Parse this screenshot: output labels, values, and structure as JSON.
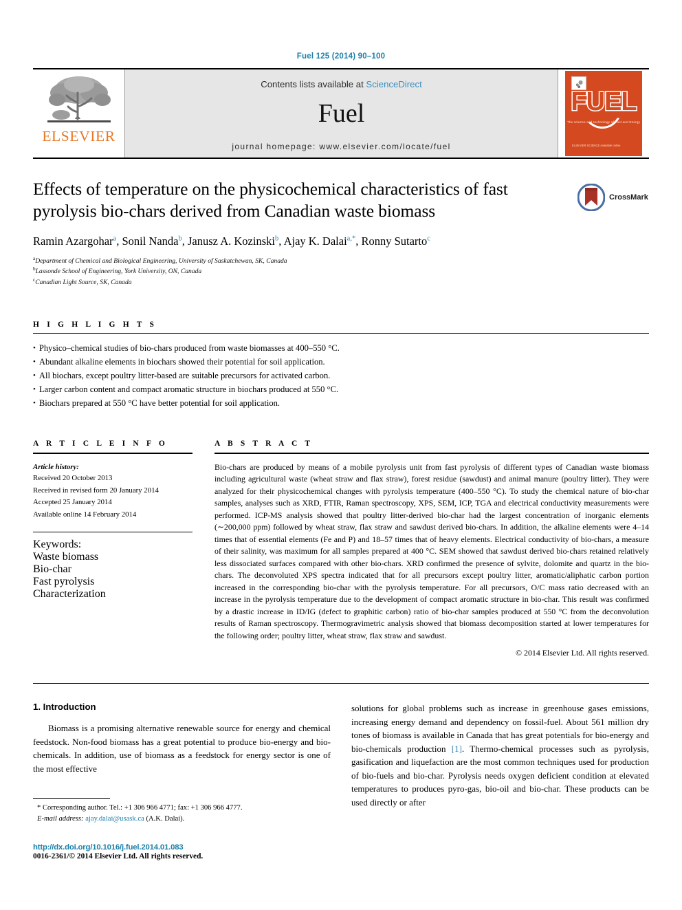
{
  "running_head": "Fuel 125 (2014) 90–100",
  "masthead": {
    "publisher_logo_text": "ELSEVIER",
    "contents_prefix": "Contents lists available at",
    "contents_link": "ScienceDirect",
    "journal_name": "Fuel",
    "homepage_line": "journal homepage: www.elsevier.com/locate/fuel",
    "cover": {
      "title": "FUEL",
      "subtitle": "The science and technology of Fuel and Energy",
      "footer": "ELSEVIER SCIENCE\nAvailable online"
    }
  },
  "article": {
    "title": "Effects of temperature on the physicochemical characteristics of fast pyrolysis bio-chars derived from Canadian waste biomass",
    "crossmark_label": "CrossMark",
    "authors": [
      {
        "name": "Ramin Azargohar",
        "sup": "a",
        "sep": ", "
      },
      {
        "name": "Sonil Nanda",
        "sup": "b",
        "sep": ", "
      },
      {
        "name": "Janusz A. Kozinski",
        "sup": "b",
        "sep": ", "
      },
      {
        "name": "Ajay K. Dalai",
        "sup": "a,*",
        "sep": ", "
      },
      {
        "name": "Ronny Sutarto",
        "sup": "c",
        "sep": ""
      }
    ],
    "affiliations": [
      {
        "sup": "a",
        "text": "Department of Chemical and Biological Engineering, University of Saskatchewan, SK, Canada"
      },
      {
        "sup": "b",
        "text": "Lassonde School of Engineering, York University, ON, Canada"
      },
      {
        "sup": "c",
        "text": "Canadian Light Source, SK, Canada"
      }
    ]
  },
  "highlights": {
    "heading": "H I G H L I G H T S",
    "items": [
      "Physico–chemical studies of bio-chars produced from waste biomasses at 400–550 °C.",
      "Abundant alkaline elements in biochars showed their potential for soil application.",
      "All biochars, except poultry litter-based are suitable precursors for activated carbon.",
      "Larger carbon content and compact aromatic structure in biochars produced at 550 °C.",
      "Biochars prepared at 550 °C have better potential for soil application."
    ]
  },
  "article_info": {
    "heading": "A R T I C L E    I N F O",
    "history_label": "Article history:",
    "history": [
      "Received 20 October 2013",
      "Received in revised form 20 January 2014",
      "Accepted 25 January 2014",
      "Available online 14 February 2014"
    ],
    "keywords_label": "Keywords:",
    "keywords": [
      "Waste biomass",
      "Bio-char",
      "Fast pyrolysis",
      "Characterization"
    ]
  },
  "abstract": {
    "heading": "A B S T R A C T",
    "text": "Bio-chars are produced by means of a mobile pyrolysis unit from fast pyrolysis of different types of Canadian waste biomass including agricultural waste (wheat straw and flax straw), forest residue (sawdust) and animal manure (poultry litter). They were analyzed for their physicochemical changes with pyrolysis temperature (400–550 °C). To study the chemical nature of bio-char samples, analyses such as XRD, FTIR, Raman spectroscopy, XPS, SEM, ICP, TGA and electrical conductivity measurements were performed. ICP-MS analysis showed that poultry litter-derived bio-char had the largest concentration of inorganic elements (∼200,000 ppm) followed by wheat straw, flax straw and sawdust derived bio-chars. In addition, the alkaline elements were 4–14 times that of essential elements (Fe and P) and 18–57 times that of heavy elements. Electrical conductivity of bio-chars, a measure of their salinity, was maximum for all samples prepared at 400 °C. SEM showed that sawdust derived bio-chars retained relatively less dissociated surfaces compared with other bio-chars. XRD confirmed the presence of sylvite, dolomite and quartz in the bio-chars. The deconvoluted XPS spectra indicated that for all precursors except poultry litter, aromatic/aliphatic carbon portion increased in the corresponding bio-char with the pyrolysis temperature. For all precursors, O/C mass ratio decreased with an increase in the pyrolysis temperature due to the development of compact aromatic structure in bio-char. This result was confirmed by a drastic increase in ID/IG (defect to graphitic carbon) ratio of bio-char samples produced at 550 °C from the deconvolution results of Raman spectroscopy. Thermogravimetric analysis showed that biomass decomposition started at lower temperatures for the following order; poultry litter, wheat straw, flax straw and sawdust.",
    "copyright": "© 2014 Elsevier Ltd. All rights reserved."
  },
  "body": {
    "section_number_title": "1. Introduction",
    "left_paragraph": "Biomass is a promising alternative renewable source for energy and chemical feedstock. Non-food biomass has a great potential to produce bio-energy and bio-chemicals. In addition, use of biomass as a feedstock for energy sector is one of the most effective",
    "right_paragraph_part1": "solutions for global problems such as increase in greenhouse gases emissions, increasing energy demand and dependency on fossil-fuel. About 561 million dry tones of biomass is available in Canada that has great potentials for bio-energy and bio-chemicals production ",
    "right_citation": "[1]",
    "right_paragraph_part2": ". Thermo-chemical processes such as pyrolysis, gasification and liquefaction are the most common techniques used for production of bio-fuels and bio-char. Pyrolysis needs oxygen deficient condition at elevated temperatures to produces pyro-gas, bio-oil and bio-char. These products can be used directly or after"
  },
  "footnotes": {
    "corresponding": "* Corresponding author. Tel.: +1 306 966 4771; fax: +1 306 966 4777.",
    "email_label": "E-mail address:",
    "email": "ajay.dalai@usask.ca",
    "email_suffix": "(A.K. Dalai).",
    "doi": "http://dx.doi.org/10.1016/j.fuel.2014.01.083",
    "issn": "0016-2361/© 2014 Elsevier Ltd. All rights reserved."
  },
  "colors": {
    "link": "#1a7fa8",
    "sciencedirect": "#3a8fbf",
    "elsevier_orange": "#e87722",
    "cover_orange": "#d4491f",
    "superscript_blue": "#2d7fae"
  }
}
